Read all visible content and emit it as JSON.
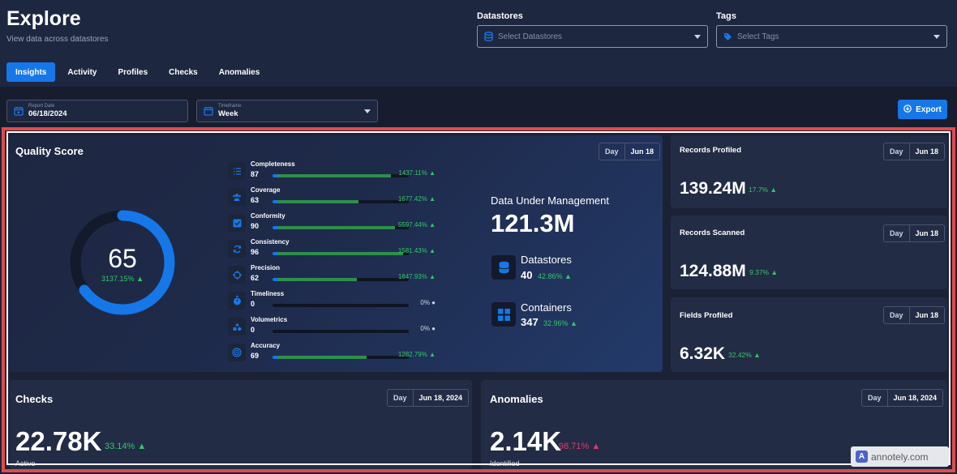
{
  "header": {
    "title": "Explore",
    "subtitle": "View data across datastores",
    "datastores_label": "Datastores",
    "datastores_placeholder": "Select Datastores",
    "tags_label": "Tags",
    "tags_placeholder": "Select Tags"
  },
  "tabs": [
    {
      "label": "Insights",
      "active": true
    },
    {
      "label": "Activity",
      "active": false
    },
    {
      "label": "Profiles",
      "active": false
    },
    {
      "label": "Checks",
      "active": false
    },
    {
      "label": "Anomalies",
      "active": false
    }
  ],
  "filters": {
    "report_date_label": "Report Date",
    "report_date_value": "06/18/2024",
    "timeframe_label": "Timeframe",
    "timeframe_value": "Week",
    "export_label": "Export"
  },
  "quality": {
    "title": "Quality Score",
    "badge_day": "Day",
    "badge_date": "Jun 18",
    "score": "65",
    "score_fraction": 0.65,
    "score_change": "3137.15%",
    "metrics": [
      {
        "name": "Completeness",
        "value": "87",
        "fraction": 0.87,
        "change": "1437.11%",
        "icon": "list-icon"
      },
      {
        "name": "Coverage",
        "value": "63",
        "fraction": 0.63,
        "change": "1677.42%",
        "icon": "users-icon"
      },
      {
        "name": "Conformity",
        "value": "90",
        "fraction": 0.9,
        "change": "5597.44%",
        "icon": "checkbox-icon"
      },
      {
        "name": "Consistency",
        "value": "96",
        "fraction": 0.96,
        "change": "1581.43%",
        "icon": "sync-icon"
      },
      {
        "name": "Precision",
        "value": "62",
        "fraction": 0.62,
        "change": "1847.93%",
        "icon": "crosshair-icon"
      },
      {
        "name": "Timeliness",
        "value": "0",
        "fraction": 0,
        "change": "0%",
        "icon": "timer-icon"
      },
      {
        "name": "Volumetrics",
        "value": "0",
        "fraction": 0,
        "change": "0%",
        "icon": "shapes-icon"
      },
      {
        "name": "Accuracy",
        "value": "69",
        "fraction": 0.69,
        "change": "1282.79%",
        "icon": "target-icon"
      }
    ],
    "dum_label": "Data Under Management",
    "dum_value": "121.3M",
    "datastores_name": "Datastores",
    "datastores_value": "40",
    "datastores_change": "42.86%",
    "containers_name": "Containers",
    "containers_value": "347",
    "containers_change": "32.96%"
  },
  "side_cards": [
    {
      "label": "Records Profiled",
      "day": "Day",
      "date": "Jun 18",
      "value": "139.24M",
      "change": "17.7%"
    },
    {
      "label": "Records Scanned",
      "day": "Day",
      "date": "Jun 18",
      "value": "124.88M",
      "change": "9.37%"
    },
    {
      "label": "Fields Profiled",
      "day": "Day",
      "date": "Jun 18",
      "value": "6.32K",
      "change": "32.42%"
    }
  ],
  "checks": {
    "title": "Checks",
    "day": "Day",
    "date": "Jun 18, 2024",
    "value": "22.78K",
    "change": "33.14%",
    "sublabel": "Active"
  },
  "anomalies": {
    "title": "Anomalies",
    "day": "Day",
    "date": "Jun 18, 2024",
    "value": "2.14K",
    "change": "98.71%",
    "sublabel": "Identified"
  },
  "colors": {
    "accent": "#1677e8",
    "positive": "#35c46a",
    "negative": "#e0386a",
    "highlight_frame": "#e14b4b"
  },
  "watermark": {
    "text": "annotely.com",
    "logo": "A"
  }
}
